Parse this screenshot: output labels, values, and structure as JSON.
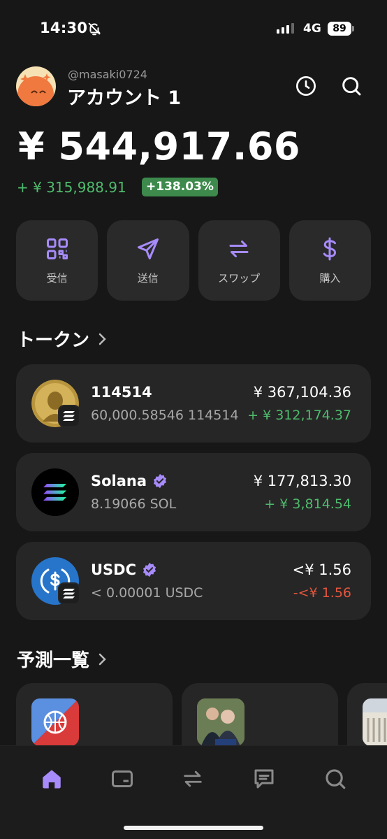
{
  "status_bar": {
    "time": "14:30",
    "network": "4G",
    "battery": "89"
  },
  "header": {
    "handle": "@masaki0724",
    "account_name": "アカウント 1"
  },
  "portfolio": {
    "balance": "¥ 544,917.66",
    "change_amount": "+ ¥ 315,988.91",
    "change_percent": "+138.03%"
  },
  "actions": [
    {
      "label": "受信",
      "icon": "qr-code-icon"
    },
    {
      "label": "送信",
      "icon": "send-icon"
    },
    {
      "label": "スワップ",
      "icon": "swap-icon"
    },
    {
      "label": "購入",
      "icon": "dollar-icon"
    }
  ],
  "tokens_section": {
    "title": "トークン"
  },
  "tokens": [
    {
      "name": "114514",
      "amount": "60,000.58546 114514",
      "value": "¥ 367,104.36",
      "change": "+ ¥ 312,174.37",
      "trend": "positive"
    },
    {
      "name": "Solana",
      "amount": "8.19066 SOL",
      "value": "¥ 177,813.30",
      "change": "+ ¥ 3,814.54",
      "trend": "positive",
      "verified": true
    },
    {
      "name": "USDC",
      "amount": "< 0.00001 USDC",
      "value": "<¥ 1.56",
      "change": "-<¥ 1.56",
      "trend": "negative",
      "verified": true
    }
  ],
  "predictions_section": {
    "title": "予測一覧"
  },
  "colors": {
    "accent": "#a78bfa",
    "positive": "#4fbb6d",
    "negative": "#e5563e",
    "background": "#171717",
    "card": "#262626"
  },
  "nav": [
    "home-icon",
    "wallet-icon",
    "swap-icon",
    "chat-icon",
    "search-icon"
  ]
}
